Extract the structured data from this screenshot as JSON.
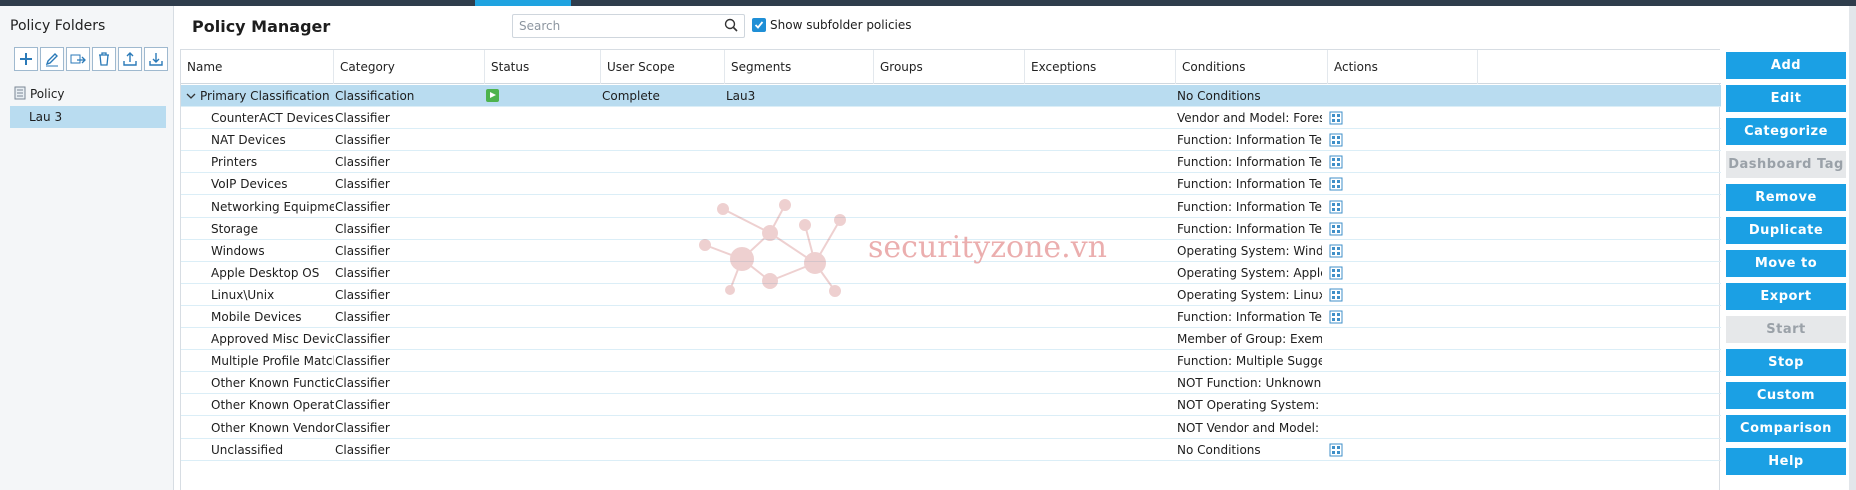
{
  "left_panel": {
    "title": "Policy Folders",
    "toolbar": [
      "add-icon",
      "edit-icon",
      "move-folder-icon",
      "delete-icon",
      "export-icon",
      "import-icon"
    ],
    "tree": {
      "root_label": "Policy",
      "selected_child": "Lau 3"
    }
  },
  "header": {
    "title": "Policy Manager",
    "search_placeholder": "Search",
    "show_subfolder_label": "Show subfolder policies",
    "show_subfolder_checked": true
  },
  "table": {
    "columns": [
      "Name",
      "Category",
      "Status",
      "User Scope",
      "Segments",
      "Groups",
      "Exceptions",
      "Conditions",
      "Actions"
    ],
    "group_row": {
      "name": "Primary Classification",
      "category": "Classification",
      "user_scope": "Complete",
      "segments": "Lau3",
      "conditions": "No Conditions"
    },
    "rows": [
      {
        "name": "CounterACT Devices",
        "category": "Classifier",
        "conditions": "Vendor and Model: Forescout ...",
        "action_icon": true
      },
      {
        "name": "NAT Devices",
        "category": "Classifier",
        "conditions": "Function: Information Technol...",
        "action_icon": true
      },
      {
        "name": "Printers",
        "category": "Classifier",
        "conditions": "Function: Information Technol...",
        "action_icon": true
      },
      {
        "name": "VoIP Devices",
        "category": "Classifier",
        "conditions": "Function: Information Technol...",
        "action_icon": true
      },
      {
        "name": "Networking Equipment",
        "category": "Classifier",
        "conditions": "Function: Information Technol...",
        "action_icon": true
      },
      {
        "name": "Storage",
        "category": "Classifier",
        "conditions": "Function: Information Technol...",
        "action_icon": true
      },
      {
        "name": "Windows",
        "category": "Classifier",
        "conditions": "Operating System: Windows",
        "action_icon": true
      },
      {
        "name": "Apple Desktop OS",
        "category": "Classifier",
        "conditions": "Operating System: Apple > Ap...",
        "action_icon": true
      },
      {
        "name": "Linux\\Unix",
        "category": "Classifier",
        "conditions": "Operating System: Linux, Unix",
        "action_icon": true
      },
      {
        "name": "Mobile Devices",
        "category": "Classifier",
        "conditions": "Function: Information Technol...",
        "action_icon": true
      },
      {
        "name": "Approved Misc Devices",
        "category": "Classifier",
        "conditions": "Member of Group: Exempt-Ap...",
        "action_icon": false
      },
      {
        "name": "Multiple Profile Matches",
        "category": "Classifier",
        "conditions": "Function: Multiple Suggestion...",
        "action_icon": false
      },
      {
        "name": "Other Known Function",
        "category": "Classifier",
        "conditions": "NOT  Function: Unknown",
        "action_icon": false
      },
      {
        "name": "Other Known Operating Sy",
        "category": "Classifier",
        "conditions": "NOT  Operating System: Unkn...",
        "action_icon": false
      },
      {
        "name": "Other Known Vendor",
        "category": "Classifier",
        "conditions": "NOT  Vendor and Model: Unkn...",
        "action_icon": false
      },
      {
        "name": "Unclassified",
        "category": "Classifier",
        "conditions": "No Conditions",
        "action_icon": true
      }
    ]
  },
  "action_buttons": [
    {
      "label": "Add",
      "enabled": true
    },
    {
      "label": "Edit",
      "enabled": true
    },
    {
      "label": "Categorize",
      "enabled": true
    },
    {
      "label": "Dashboard Tag",
      "enabled": false
    },
    {
      "label": "Remove",
      "enabled": true
    },
    {
      "label": "Duplicate",
      "enabled": true
    },
    {
      "label": "Move to",
      "enabled": true
    },
    {
      "label": "Export",
      "enabled": true
    },
    {
      "label": "Start",
      "enabled": false
    },
    {
      "label": "Stop",
      "enabled": true
    },
    {
      "label": "Custom",
      "enabled": true
    },
    {
      "label": "Comparison",
      "enabled": true
    },
    {
      "label": "Help",
      "enabled": true
    }
  ],
  "watermark": {
    "text": "securityzone.vn"
  },
  "colors": {
    "accent": "#1ba0e4",
    "selection": "#b9dcf0",
    "status_running": "#4db34d"
  }
}
